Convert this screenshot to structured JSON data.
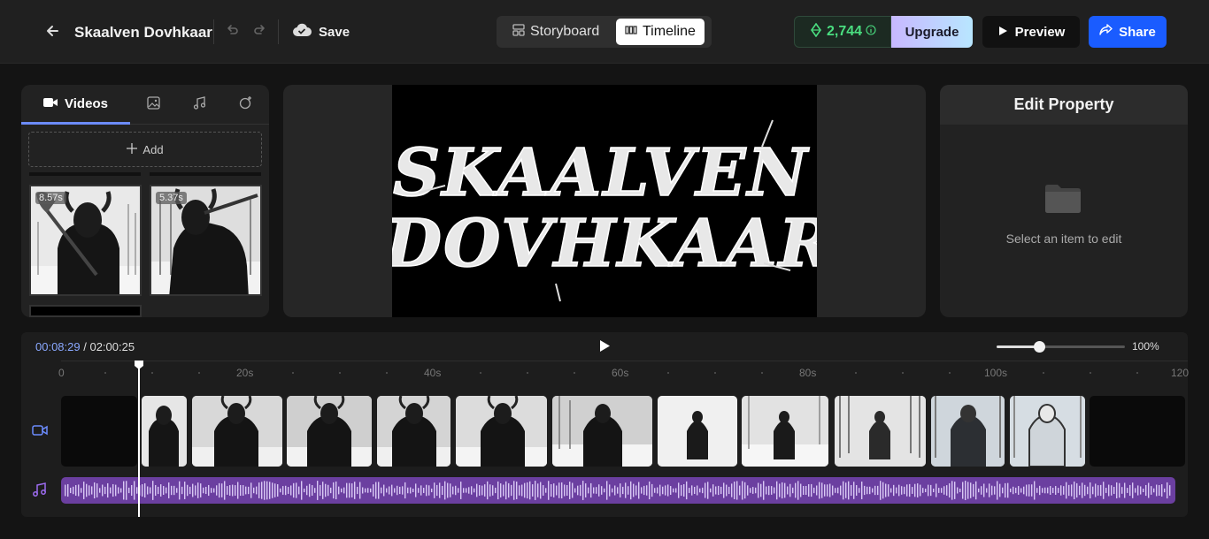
{
  "header": {
    "project_title": "Skaalven Dovhkaar",
    "save_label": "Save",
    "view_tabs": [
      {
        "label": "Storyboard"
      },
      {
        "label": "Timeline"
      }
    ],
    "active_view": "Timeline",
    "credits": "2,744",
    "upgrade_label": "Upgrade",
    "preview_label": "Preview",
    "share_label": "Share",
    "colors": {
      "credits": "#4ade80",
      "share": "#1a5cff"
    }
  },
  "media_panel": {
    "tabs": [
      {
        "label": "Videos",
        "icon": "video-camera-icon"
      },
      {
        "label": "",
        "icon": "image-icon"
      },
      {
        "label": "",
        "icon": "music-note-icon"
      },
      {
        "label": "",
        "icon": "effects-icon"
      }
    ],
    "add_label": "Add",
    "items": [
      {
        "duration": "8.57s"
      },
      {
        "duration": "5.37s"
      }
    ]
  },
  "preview": {
    "title_line1": "SKAALVEN",
    "title_line2": "DOVHKAAR"
  },
  "properties": {
    "title": "Edit Property",
    "empty_text": "Select an item to edit"
  },
  "timeline": {
    "current_time": "00:08:29",
    "total_time": "/ 02:00:25",
    "zoom": "100%",
    "zoom_level": 0.33,
    "ruler_labels": [
      "0",
      "20s",
      "40s",
      "60s",
      "80s",
      "100s",
      "120"
    ]
  }
}
